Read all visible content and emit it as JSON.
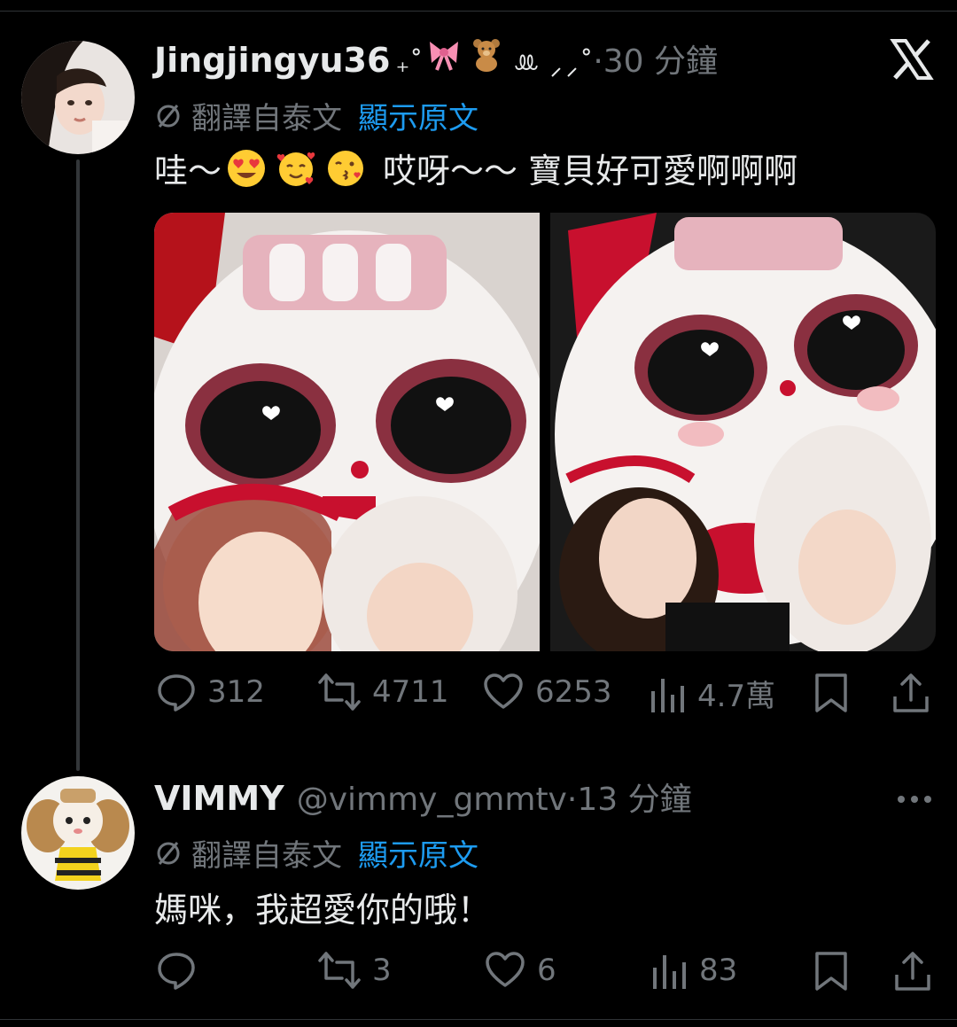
{
  "tweet": {
    "display_name": "Jingjingyu36",
    "name_decoration": "₊˚",
    "name_decoration_tail": "ꔛ ⸝⸝˚",
    "dot": "·",
    "time": "30 分鐘",
    "translate_label": "翻譯自泰文",
    "show_original": "顯示原文",
    "text_part1": "哇～",
    "text_part2": "哎呀～～ 寶貝好可愛啊啊啊",
    "emojis": [
      "heart-eyes-emoji",
      "smiling-hearts-emoji",
      "kiss-emoji"
    ],
    "replies": "312",
    "reposts": "4711",
    "likes": "6253",
    "views": "4.7萬"
  },
  "reply": {
    "display_name": "VIMMY",
    "handle": "@vimmy_gmmtv",
    "dot": "·",
    "time": "13 分鐘",
    "translate_label": "翻譯自泰文",
    "show_original": "顯示原文",
    "text": "媽咪，我超愛你的哦！",
    "replies": "",
    "reposts": "3",
    "likes": "6",
    "views": "83"
  },
  "colors": {
    "background": "#000000",
    "text": "#e7e9ea",
    "muted": "#71767b",
    "link": "#1d9bf0"
  }
}
